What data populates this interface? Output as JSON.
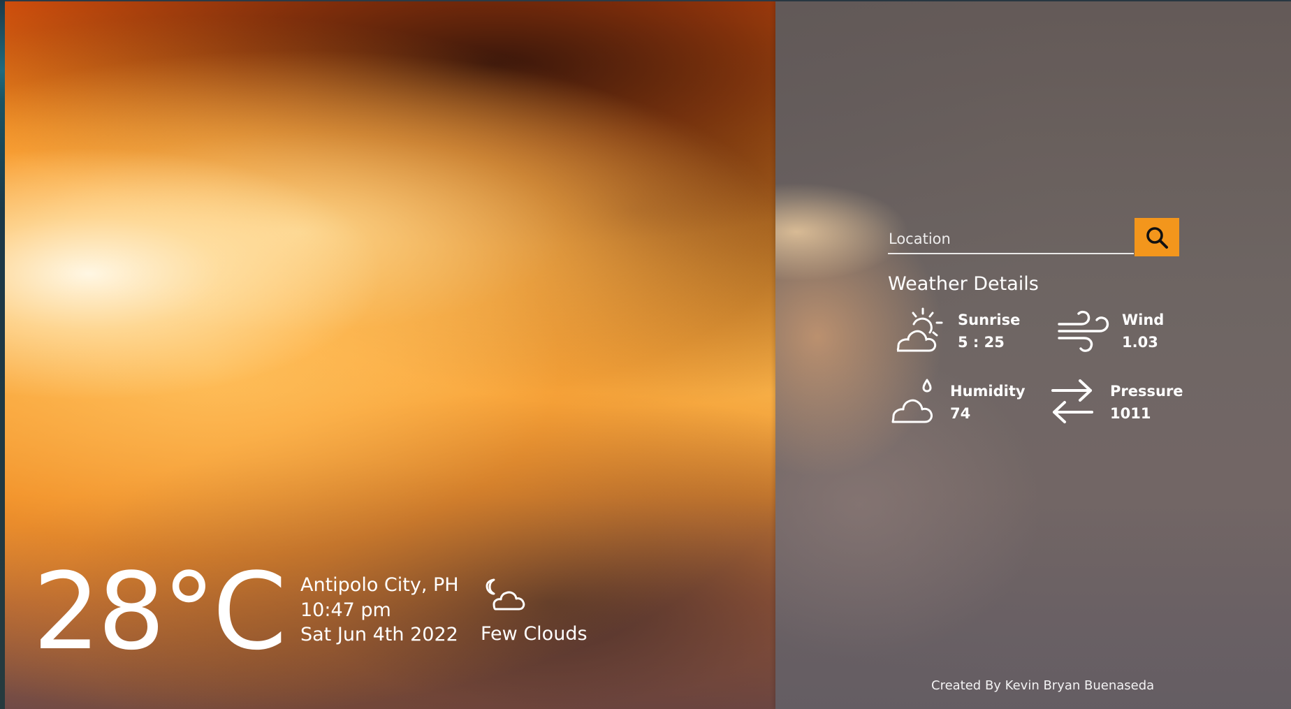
{
  "search": {
    "placeholder": "Location",
    "value": ""
  },
  "details": {
    "title": "Weather Details",
    "items": [
      {
        "label": "Sunrise",
        "value": "5 : 25",
        "icon": "sun-cloud-icon"
      },
      {
        "label": "Wind",
        "value": "1.03",
        "icon": "wind-icon"
      },
      {
        "label": "Humidity",
        "value": "74",
        "icon": "cloud-drop-icon"
      },
      {
        "label": "Pressure",
        "value": "1011",
        "icon": "arrows-left-right-icon"
      }
    ]
  },
  "current": {
    "temperature": "28°C",
    "location": "Antipolo City, PH",
    "time": "10:47 pm",
    "date": "Sat Jun 4th 2022",
    "condition": "Few Clouds",
    "condition_icon": "moon-cloud-icon"
  },
  "footer": {
    "credit": "Created By Kevin Bryan Buenaseda"
  },
  "colors": {
    "accent": "#f3961c",
    "text": "#ffffff"
  }
}
